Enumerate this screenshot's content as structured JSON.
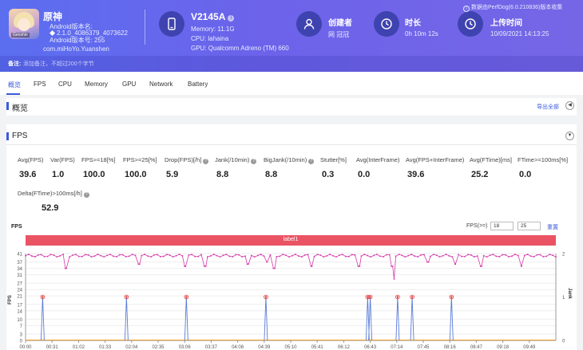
{
  "header": {
    "app": {
      "name": "原神",
      "version_line": "Android版本名:",
      "version_value": "2.1.0_4086379_4073622",
      "build_line": "Android版本号: 255",
      "package": "com.miHoYo.Yuanshen",
      "icon_tag": "Genshin"
    },
    "device": {
      "name": "V2145A",
      "memory": "Memory: 11.1G",
      "cpu": "CPU: lahaina",
      "gpu": "GPU: Qualcomm Adreno (TM) 660"
    },
    "creator": {
      "title": "创建者",
      "value": "网 冠冠"
    },
    "duration": {
      "title": "时长",
      "value": "0h 10m 12s"
    },
    "upload": {
      "title": "上传时间",
      "value": "10/09/2021 14:13:25"
    },
    "data_source": "数据由PerfDog(6.0.210836)版本收集",
    "remark_label": "备注:",
    "remark_placeholder": "添加备注，不超过200个字节"
  },
  "tabs": [
    "概览",
    "FPS",
    "CPU",
    "Memory",
    "GPU",
    "Network",
    "Battery"
  ],
  "overview": {
    "title": "概览",
    "export": "导出全部"
  },
  "fps": {
    "title": "FPS",
    "metrics": [
      {
        "label": "Avg(FPS)",
        "value": "39.6",
        "help": false
      },
      {
        "label": "Var(FPS)",
        "value": "1.0",
        "help": false
      },
      {
        "label": "FPS>=18[%]",
        "value": "100.0",
        "help": false
      },
      {
        "label": "FPS>=25[%]",
        "value": "100.0",
        "help": false
      },
      {
        "label": "Drop(FPS)[/h]",
        "value": "5.9",
        "help": true
      },
      {
        "label": "Jank(/10min)",
        "value": "8.8",
        "help": true
      },
      {
        "label": "BigJank(/10min)",
        "value": "8.8",
        "help": true
      },
      {
        "label": "Stutter[%]",
        "value": "0.3",
        "help": false
      },
      {
        "label": "Avg(InterFrame)",
        "value": "0.0",
        "help": false
      },
      {
        "label": "Avg(FPS+InterFrame)",
        "value": "39.6",
        "help": false
      },
      {
        "label": "Avg(FTime)[ms]",
        "value": "25.2",
        "help": false
      },
      {
        "label": "FTime>=100ms[%]",
        "value": "0.0",
        "help": false
      },
      {
        "label": "Delta(FTime)>100ms[/h]",
        "value": "52.9",
        "help": true
      }
    ],
    "chart_title": "FPS",
    "fps_ge_label": "FPS(>=)",
    "threshold_1": "18",
    "threshold_2": "25",
    "reset": "重置",
    "label_band": "label1"
  },
  "colors": {
    "accent": "#3b5bdb",
    "fps_line": "#d63aa8",
    "jank_line": "#5a7bd6",
    "jank_marker": "#e53935",
    "label_band": "#ea5363"
  },
  "chart_data": {
    "type": "line",
    "series": [],
    "y_left": {
      "label": "FPS",
      "ticks": [
        0,
        3,
        7,
        10,
        14,
        17,
        21,
        24,
        27,
        31,
        34,
        37,
        41
      ],
      "range": [
        0,
        41
      ]
    },
    "y_right": {
      "label": "Jank",
      "ticks": [
        0,
        1,
        2
      ],
      "range": [
        0,
        2
      ]
    },
    "x_ticks": [
      "00:00",
      "00:31",
      "01:02",
      "01:33",
      "02:04",
      "02:35",
      "03:06",
      "03:37",
      "04:08",
      "04:39",
      "05:10",
      "05:41",
      "06:12",
      "06:43",
      "07:14",
      "07:45",
      "08:16",
      "08:47",
      "09:18",
      "09:49"
    ],
    "fps_typical": 40,
    "fps_dips": [
      {
        "t": 0.075,
        "v": 34
      },
      {
        "t": 0.215,
        "v": 36
      },
      {
        "t": 0.3,
        "v": 35
      },
      {
        "t": 0.34,
        "v": 35
      },
      {
        "t": 0.418,
        "v": 36
      },
      {
        "t": 0.455,
        "v": 37
      },
      {
        "t": 0.47,
        "v": 34
      },
      {
        "t": 0.54,
        "v": 35
      },
      {
        "t": 0.63,
        "v": 35
      },
      {
        "t": 0.695,
        "v": 29
      },
      {
        "t": 0.69,
        "v": 35
      },
      {
        "t": 0.76,
        "v": 37
      },
      {
        "t": 0.81,
        "v": 36
      },
      {
        "t": 0.86,
        "v": 35
      },
      {
        "t": 0.935,
        "v": 35
      }
    ],
    "jank_events": [
      {
        "time": "00:20",
        "jank": 1
      },
      {
        "time": "01:58",
        "jank": 1
      },
      {
        "time": "03:08",
        "jank": 1
      },
      {
        "time": "04:41",
        "jank": 1
      },
      {
        "time": "06:40",
        "jank": 1
      },
      {
        "time": "06:43",
        "jank": 1
      },
      {
        "time": "07:15",
        "jank": 1
      },
      {
        "time": "07:32",
        "jank": 1
      },
      {
        "time": "08:18",
        "jank": 1
      }
    ]
  }
}
